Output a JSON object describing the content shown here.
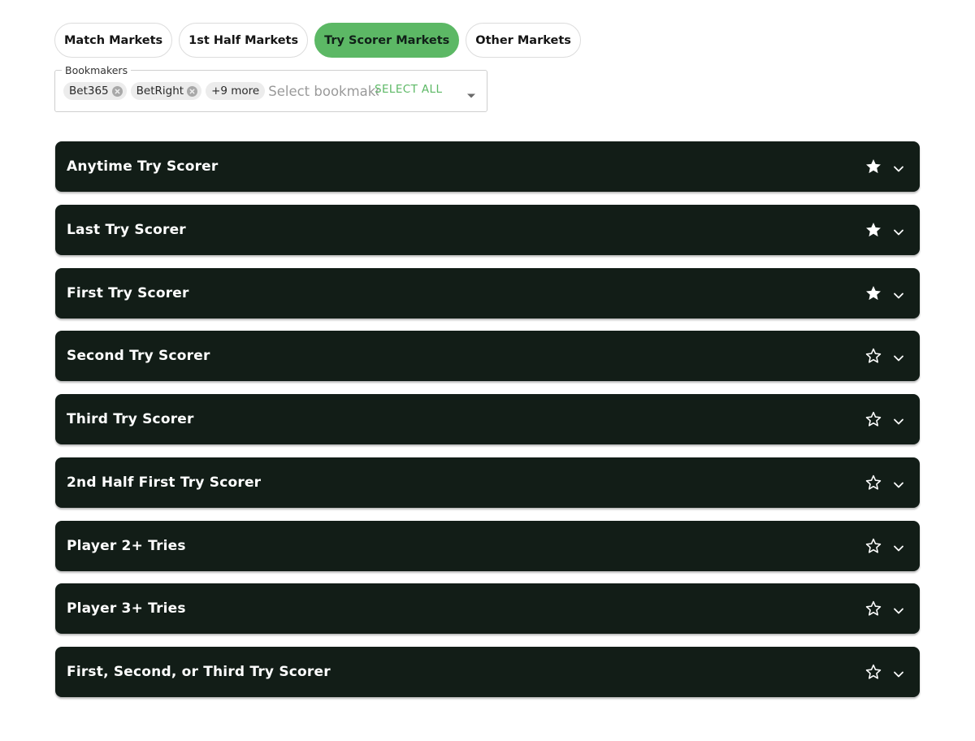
{
  "tabs": [
    {
      "label": "Match Markets",
      "active": false
    },
    {
      "label": "1st Half Markets",
      "active": false
    },
    {
      "label": "Try Scorer Markets",
      "active": true
    },
    {
      "label": "Other Markets",
      "active": false
    }
  ],
  "bookmakers": {
    "label": "Bookmakers",
    "chips": [
      "Bet365",
      "BetRight"
    ],
    "more_label": "+9 more",
    "placeholder": "Select bookmakers",
    "select_all_label": "SELECT ALL"
  },
  "markets": [
    {
      "title": "Anytime Try Scorer",
      "favourite": true
    },
    {
      "title": "Last Try Scorer",
      "favourite": true
    },
    {
      "title": "First Try Scorer",
      "favourite": true
    },
    {
      "title": "Second Try Scorer",
      "favourite": false
    },
    {
      "title": "Third Try Scorer",
      "favourite": false
    },
    {
      "title": "2nd Half First Try Scorer",
      "favourite": false
    },
    {
      "title": "Player 2+ Tries",
      "favourite": false
    },
    {
      "title": "Player 3+ Tries",
      "favourite": false
    },
    {
      "title": "First, Second, or Third Try Scorer",
      "favourite": false
    }
  ],
  "icons": {
    "chip_remove": "close-circle-icon",
    "dropdown": "caret-down-icon",
    "favourite_on": "star-filled-icon",
    "favourite_off": "star-outline-icon",
    "expand": "chevron-down-icon"
  },
  "colors": {
    "accent": "#5cb865",
    "row_background": "#121d17",
    "row_text": "#ffffff"
  }
}
